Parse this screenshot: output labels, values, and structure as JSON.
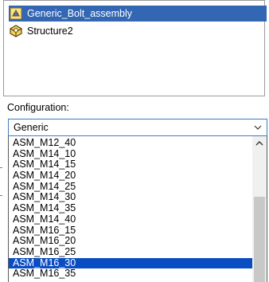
{
  "tree": {
    "items": [
      {
        "label": "Generic_Bolt_assembly",
        "icon": "assembly-icon",
        "selected": true
      },
      {
        "label": "Structure2",
        "icon": "part-icon",
        "selected": false
      }
    ]
  },
  "configuration": {
    "label": "Configuration:",
    "selected_value": "Generic",
    "options": [
      "ASM_M12_40",
      "ASM_M14_10",
      "ASM_M14_15",
      "ASM_M14_20",
      "ASM_M14_25",
      "ASM_M14_30",
      "ASM_M14_35",
      "ASM_M14_40",
      "ASM_M16_15",
      "ASM_M16_20",
      "ASM_M16_25",
      "ASM_M16_30",
      "ASM_M16_35"
    ],
    "highlighted_option": "ASM_M16_30"
  },
  "colors": {
    "tree_selection": "#3366b3",
    "list_selection": "#0a4cc2",
    "combo_border": "#3d7ac6"
  }
}
